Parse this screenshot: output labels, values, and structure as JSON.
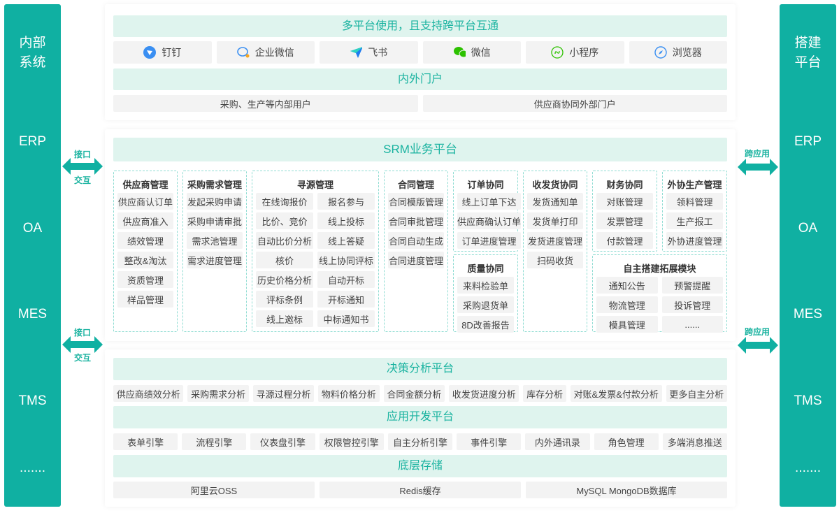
{
  "left_bar": {
    "title_1": "内部",
    "title_2": "系统",
    "items": [
      "ERP",
      "OA",
      "MES",
      "TMS",
      "......."
    ]
  },
  "right_bar": {
    "title_1": "搭建",
    "title_2": "平台",
    "items": [
      "ERP",
      "OA",
      "MES",
      "TMS",
      "......."
    ]
  },
  "connectors": {
    "left_top": "接口",
    "left_bottom": "交互",
    "right": "跨应用"
  },
  "top": {
    "header": "多平台使用，且支持跨平台互通",
    "platforms": [
      {
        "label": "钉钉",
        "icon": "dingtalk-icon"
      },
      {
        "label": "企业微信",
        "icon": "wecom-icon"
      },
      {
        "label": "飞书",
        "icon": "feishu-icon"
      },
      {
        "label": "微信",
        "icon": "wechat-icon"
      },
      {
        "label": "小程序",
        "icon": "miniprogram-icon"
      },
      {
        "label": "浏览器",
        "icon": "browser-icon"
      }
    ],
    "portal_header": "内外门户",
    "portals": [
      "采购、生产等内部用户",
      "供应商协同外部门户"
    ]
  },
  "srm": {
    "header": "SRM业务平台",
    "modules": [
      {
        "title": "供应商管理",
        "items": [
          "供应商认订单",
          "供应商准入",
          "绩效管理",
          "整改&淘汰",
          "资质管理",
          "样品管理"
        ]
      },
      {
        "title": "采购需求管理",
        "items": [
          "发起采购申请",
          "采购申请审批",
          "需求池管理",
          "需求进度管理"
        ]
      },
      {
        "title": "寻源管理",
        "items": [
          "在线询报价",
          "报名参与",
          "比价、竞价",
          "线上投标",
          "自动比价分析",
          "线上答疑",
          "核价",
          "线上协同评标",
          "历史价格分析",
          "自动开标",
          "评标条例",
          "开标通知",
          "线上邀标",
          "中标通知书"
        ]
      },
      {
        "title": "合同管理",
        "items": [
          "合同模版管理",
          "合同审批管理",
          "合同自动生成",
          "合同进度管理"
        ]
      },
      {
        "title": "订单协同",
        "items": [
          "线上订单下达",
          "供应商确认订单",
          "订单进度管理"
        ]
      },
      {
        "title": "质量协同",
        "items": [
          "来料检验单",
          "采购退货单",
          "8D改善报告"
        ]
      },
      {
        "title": "收发货协同",
        "items": [
          "发货通知单",
          "发货单打印",
          "发货进度管理",
          "扫码收货"
        ]
      },
      {
        "title": "财务协同",
        "items": [
          "对账管理",
          "发票管理",
          "付款管理"
        ]
      },
      {
        "title": "外协生产管理",
        "items": [
          "领料管理",
          "生产报工",
          "外协进度管理"
        ]
      },
      {
        "title": "自主搭建拓展模块",
        "items": [
          "通知公告",
          "预警提醒",
          "物流管理",
          "投诉管理",
          "模具管理",
          "......"
        ]
      }
    ]
  },
  "analysis": {
    "header": "决策分析平台",
    "items": [
      "供应商绩效分析",
      "采购需求分析",
      "寻源过程分析",
      "物料价格分析",
      "合同金额分析",
      "收发货进度分析",
      "库存分析",
      "对账&发票&付款分析",
      "更多自主分析"
    ]
  },
  "devplatform": {
    "header": "应用开发平台",
    "items": [
      "表单引擎",
      "流程引擎",
      "仪表盘引擎",
      "权限管控引擎",
      "自主分析引擎",
      "事件引擎",
      "内外通讯录",
      "角色管理",
      "多端消息推送"
    ]
  },
  "storage": {
    "header": "底层存储",
    "items": [
      "阿里云OSS",
      "Redis缓存",
      "MySQL MongoDB数据库"
    ]
  },
  "colors": {
    "accent": "#10b0a2",
    "header_bg": "#dff4ee",
    "cell_bg": "#f3f3f3"
  }
}
